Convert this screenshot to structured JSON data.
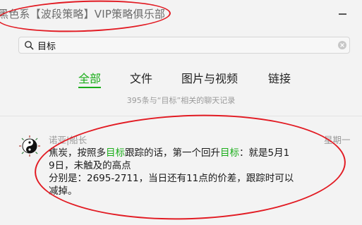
{
  "window": {
    "title": "黑色系【波段策略】VIP策略俱乐部"
  },
  "search": {
    "value": "目标",
    "placeholder": "",
    "search_icon": "search-icon",
    "clear_icon": "clear-icon"
  },
  "tabs": [
    {
      "label": "全部",
      "active": true
    },
    {
      "label": "文件",
      "active": false
    },
    {
      "label": "图片与视频",
      "active": false
    },
    {
      "label": "链接",
      "active": false
    }
  ],
  "result_summary": "395条与“目标”相关的聊天记录",
  "messages": [
    {
      "sender": "诺亚|船长",
      "date": "星期一",
      "avatar_icon": "yin-yang-avatar",
      "lines": [
        [
          "焦炭，按照多",
          "目标",
          "跟踪的话，第一个回升",
          "目标",
          "：就是5月1"
        ],
        [
          "9日，未触及的高点"
        ],
        [
          "分别是：2695-2711，当日还有11点的价差，跟踪时可以"
        ],
        [
          "减掉。"
        ]
      ]
    }
  ],
  "colors": {
    "accent": "#1aad19",
    "annotation": "#e21b23",
    "background": "#f3f3f3",
    "muted_text": "#9a9a9a"
  }
}
